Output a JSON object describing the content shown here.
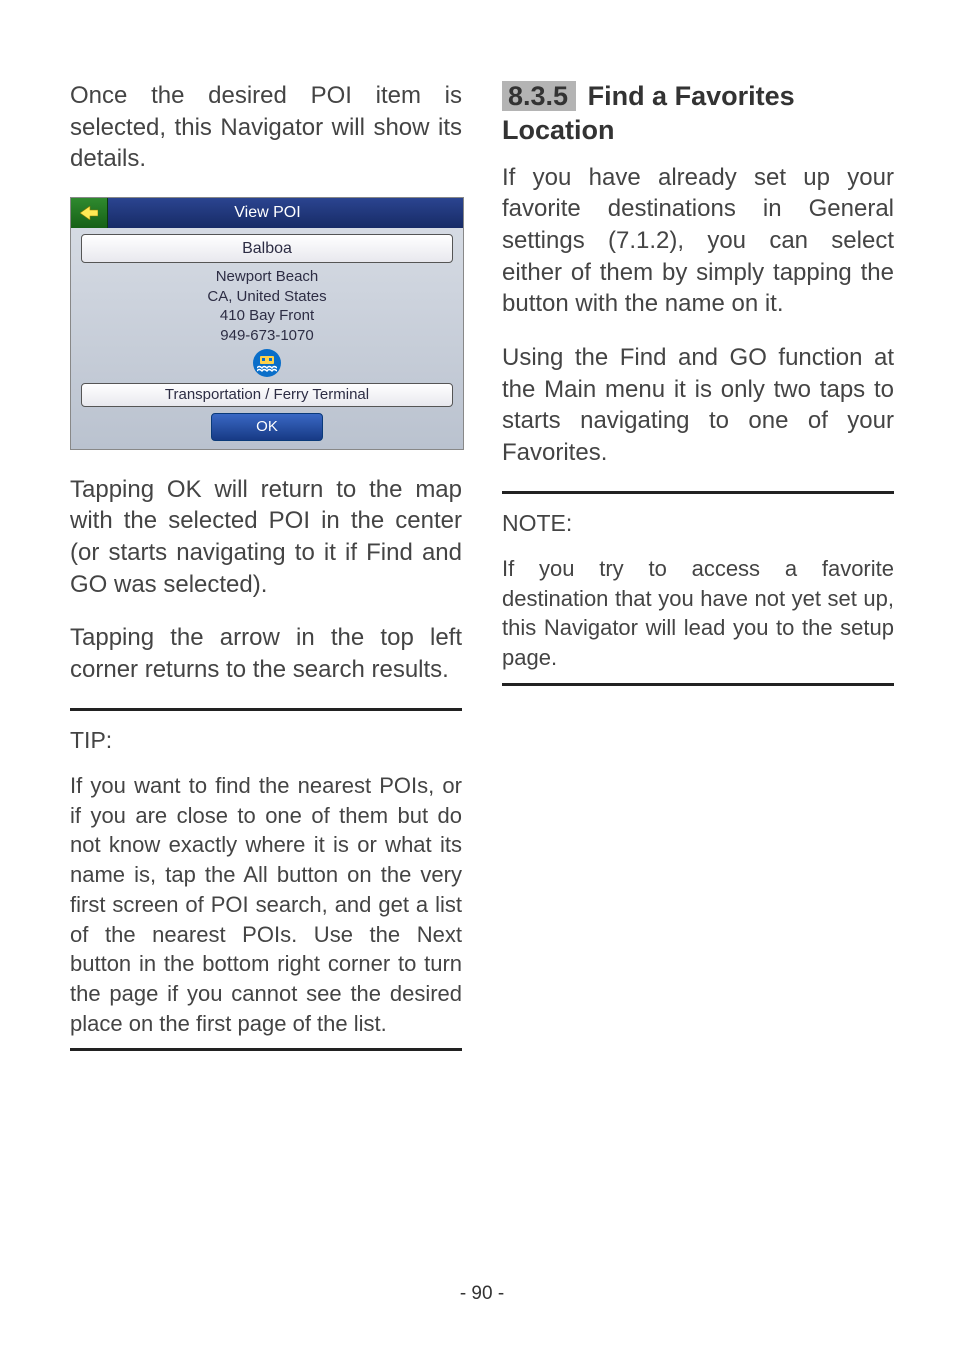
{
  "left": {
    "intro": "Once the desired POI item is selected, this Navigator will show its details.",
    "after1": "Tapping OK will return to the map with the selected POI in the center (or starts navigating to it if Find and GO was selected).",
    "after2": "Tapping the arrow in the top left corner returns to the search results.",
    "tip_label": "TIP:",
    "tip_body": "If you want to find the nearest POIs, or if you are close to one of them but do not know exactly where it is or what its name is, tap the All button on the very first screen of POI search, and get a list of the nearest POIs. Use the Next button in the bottom right corner to turn the page if you cannot see the desired place on the first page of the list."
  },
  "screenshot": {
    "header_title": "View POI",
    "poi_name": "Balboa",
    "line1": "Newport Beach",
    "line2": "CA, United States",
    "line3": "410 Bay Front",
    "line4": "949-673-1070",
    "category": "Transportation / Ferry Terminal",
    "ok_label": "OK"
  },
  "right": {
    "section_number": "8.3.5",
    "section_title_rest": "Find a Favorites Location",
    "para1": "If you have already set up your favorite destinations in General settings (7.1.2), you can select either of them by simply tapping the button with the name on it.",
    "para2": "Using the Find and GO function at the Main menu it is only two taps to starts navigating to one of your Favorites.",
    "note_label": "NOTE:",
    "note_body": "If you try to access a favorite destination that you have not yet set up, this Navigator will lead you to the setup page."
  },
  "page_number": "- 90 -"
}
